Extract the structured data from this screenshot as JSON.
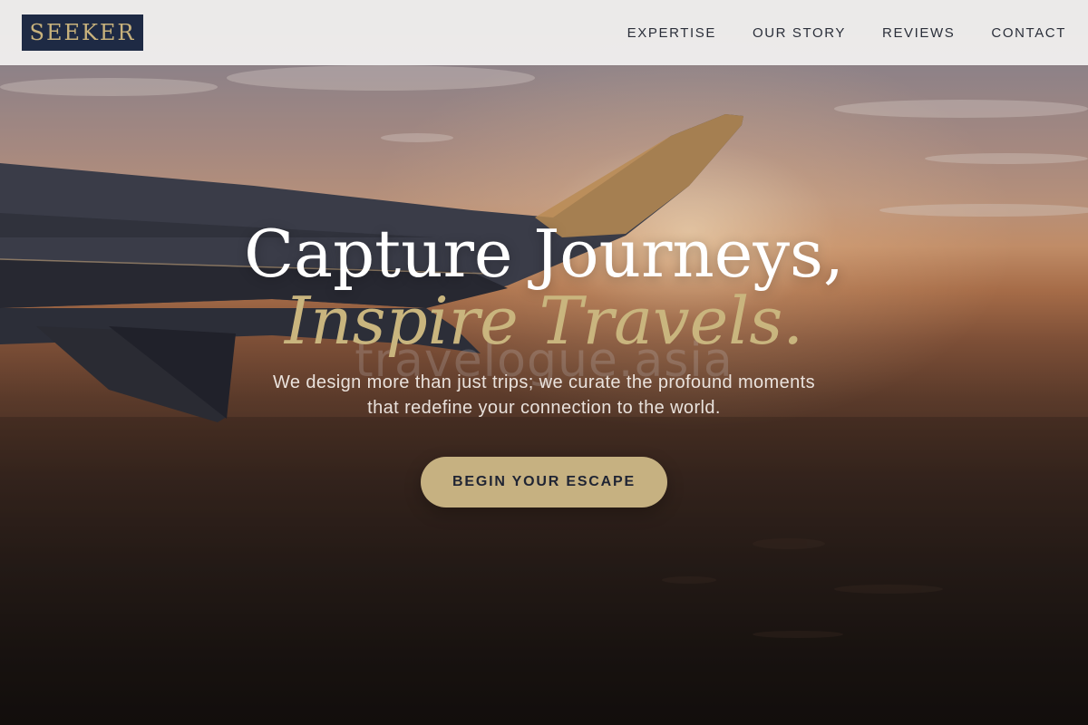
{
  "brand": {
    "logo_text": "SEEKER",
    "logo_bg": "#1e2a44",
    "logo_color": "#c8b27c"
  },
  "nav": {
    "items": [
      {
        "label": "EXPERTISE"
      },
      {
        "label": "OUR STORY"
      },
      {
        "label": "REVIEWS"
      },
      {
        "label": "CONTACT"
      }
    ]
  },
  "hero": {
    "headline_line1": "Capture Journeys,",
    "headline_line2": "Inspire Travels.",
    "watermark": "travelogue.asia",
    "subtitle_line1": "We design more than just trips; we curate the profound moments",
    "subtitle_line2": "that redefine your connection to the world.",
    "cta_label": "BEGIN YOUR ESCAPE",
    "background": "airplane-wing-sunset-photo",
    "accent_color": "#c6b181"
  }
}
